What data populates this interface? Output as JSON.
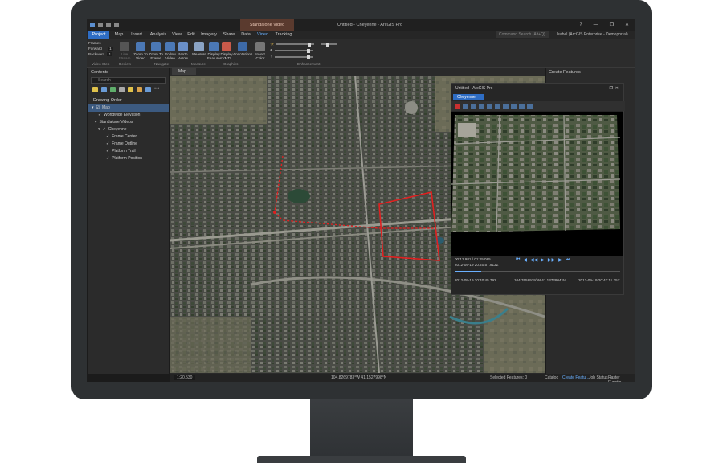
{
  "window": {
    "context_tab": "Standalone Video",
    "title": "Untitled - Cheyenne - ArcGIS Pro",
    "buttons": [
      "?",
      "—",
      "❐",
      "✕"
    ]
  },
  "tabs": [
    "Project",
    "Map",
    "Insert",
    "Analysis",
    "View",
    "Edit",
    "Imagery",
    "Share",
    "Data",
    "Video",
    "Tracking"
  ],
  "command_search": {
    "placeholder": "Command Search (Alt+Q)"
  },
  "user": "Isabel (ArcGIS Enterprise - Demoportal)",
  "ribbon": {
    "frames": {
      "label": "Frames",
      "forward": "Forward",
      "backward": "Backward",
      "forward_val": "1",
      "backward_val": "1"
    },
    "buttons": [
      "Live Stream",
      "Zoom To Video",
      "Zoom To Frame",
      "Follow Video",
      "North Arrow",
      "Measure",
      "Display Features",
      "Display VMTI",
      "Annotations",
      "Invert Color"
    ],
    "groups": [
      "Video Step",
      "Review",
      "Navigate",
      "Measure",
      "Graphics",
      "Enhancement"
    ]
  },
  "contents": {
    "title": "Contents",
    "search_placeholder": "Search",
    "drawing_order": "Drawing Order",
    "items": [
      {
        "label": "Map",
        "level": 0,
        "checked": true,
        "selected": true
      },
      {
        "label": "Worldwide Elevation",
        "level": 1,
        "checked": true
      },
      {
        "label": "Standalone Videos",
        "level": 1,
        "checked": false
      },
      {
        "label": "Cheyenne",
        "level": 2,
        "checked": true
      },
      {
        "label": "Frame Center",
        "level": 3,
        "checked": true
      },
      {
        "label": "Frame Outline",
        "level": 3,
        "checked": true
      },
      {
        "label": "Platform Trail",
        "level": 3,
        "checked": true
      },
      {
        "label": "Platform Position",
        "level": 3,
        "checked": true
      }
    ]
  },
  "map": {
    "tab": "Map",
    "scale": "1:20,530",
    "coords": "104.8269783°W 41.1527998°N",
    "selected_features": "Selected Features: 0"
  },
  "create_features": {
    "title": "Create Features"
  },
  "video_window": {
    "title": "Untitled - ArcGIS Pro",
    "tab": "Cheyenne",
    "elapsed": "00:13.981 / 01:25.085",
    "timestamp": "2012-09-19 20:40:57.913Z",
    "start": "2012-09-19 20:40:45.792",
    "coords": "104.7658919°W 41.1372804°N",
    "end": "2012-09-19 20:42:11.25Z"
  },
  "bottom_tabs": [
    "Catalog",
    "Create Featu...",
    "Job Status",
    "Raster Functio..."
  ],
  "accent_color": "#2e6dc4",
  "trail_color": "#e02020"
}
